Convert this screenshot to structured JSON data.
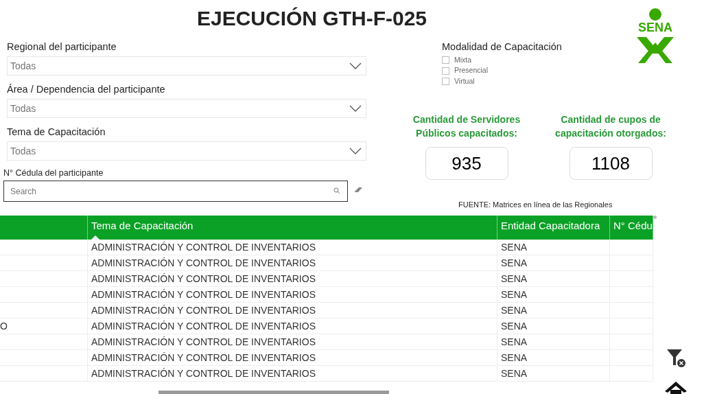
{
  "title": "EJECUCIÓN GTH-F-025",
  "logo": {
    "text": "SENA"
  },
  "filters": [
    {
      "label": "Regional del participante",
      "value": "Todas"
    },
    {
      "label": "Área / Dependencia del participante",
      "value": "Todas"
    },
    {
      "label": "Tema de Capacitación",
      "value": "Todas"
    }
  ],
  "search": {
    "label": "N° Cédula del participante",
    "placeholder": "Search"
  },
  "modalidad": {
    "label": "Modalidad de Capacitación",
    "options": [
      {
        "label": "Mixta",
        "checked": false
      },
      {
        "label": "Presencial",
        "checked": false
      },
      {
        "label": "Virtual",
        "checked": false
      }
    ]
  },
  "cards": [
    {
      "label": "Cantidad de Servidores Públicos capacitados:",
      "value": "935"
    },
    {
      "label": "Cantidad de cupos de capacitación otorgados:",
      "value": "1108"
    }
  ],
  "source": "FUENTE: Matrices en línea de las Regionales",
  "table": {
    "columns": [
      {},
      {
        "label": "Tema de Capacitación",
        "sorted": true
      },
      {
        "label": "Entidad Capacitadora"
      },
      {
        "label": "N° Cédu"
      }
    ],
    "rows": [
      [
        "",
        "ADMINISTRACIÓN Y CONTROL DE INVENTARIOS",
        "SENA",
        ""
      ],
      [
        "",
        "ADMINISTRACIÓN Y CONTROL DE INVENTARIOS",
        "SENA",
        ""
      ],
      [
        "",
        "ADMINISTRACIÓN Y CONTROL DE INVENTARIOS",
        "SENA",
        ""
      ],
      [
        "",
        "ADMINISTRACIÓN Y CONTROL DE INVENTARIOS",
        "SENA",
        ""
      ],
      [
        "",
        "ADMINISTRACIÓN Y CONTROL DE INVENTARIOS",
        "SENA",
        ""
      ],
      [
        "O",
        "ADMINISTRACIÓN Y CONTROL DE INVENTARIOS",
        "SENA",
        ""
      ],
      [
        "",
        "ADMINISTRACIÓN Y CONTROL DE INVENTARIOS",
        "SENA",
        ""
      ],
      [
        "",
        "ADMINISTRACIÓN Y CONTROL DE INVENTARIOS",
        "SENA",
        ""
      ],
      [
        "",
        "ADMINISTRACIÓN Y CONTROL DE INVENTARIOS",
        "SENA",
        ""
      ]
    ]
  }
}
